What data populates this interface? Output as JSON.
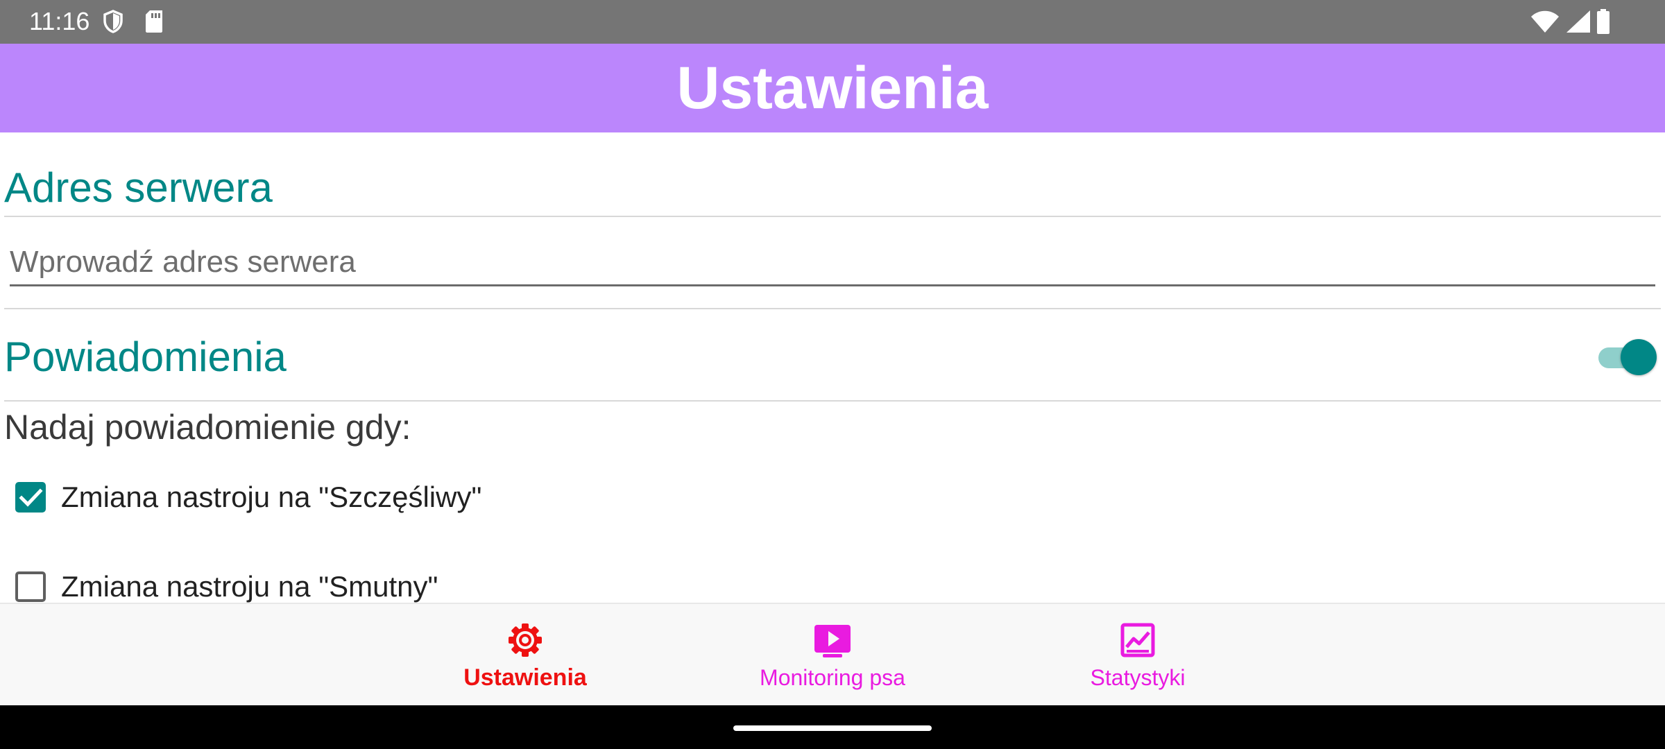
{
  "status_bar": {
    "time": "11:16",
    "icons": [
      "shield-icon",
      "sd-card-icon",
      "wifi-icon",
      "signal-icon",
      "battery-icon"
    ]
  },
  "app_bar": {
    "title": "Ustawienia",
    "color": "#bb86fc"
  },
  "server": {
    "title": "Adres serwera",
    "input_value": "",
    "input_placeholder": "Wprowadź adres serwera"
  },
  "notifications": {
    "title": "Powiadomienia",
    "enabled": true,
    "prompt": "Nadaj powiadomienie gdy:",
    "options": [
      {
        "label": "Zmiana nastroju na \"Szczęśliwy\"",
        "checked": true
      },
      {
        "label": "Zmiana nastroju na \"Smutny\"",
        "checked": false
      }
    ]
  },
  "bottom_nav": {
    "items": [
      {
        "label": "Ustawienia",
        "icon": "gear-icon",
        "active": true
      },
      {
        "label": "Monitoring psa",
        "icon": "play-screen-icon",
        "active": false
      },
      {
        "label": "Statystyki",
        "icon": "chart-icon",
        "active": false
      }
    ]
  },
  "colors": {
    "accent": "#018786",
    "nav_active": "#ee1111",
    "nav_inactive": "#e91be0"
  }
}
